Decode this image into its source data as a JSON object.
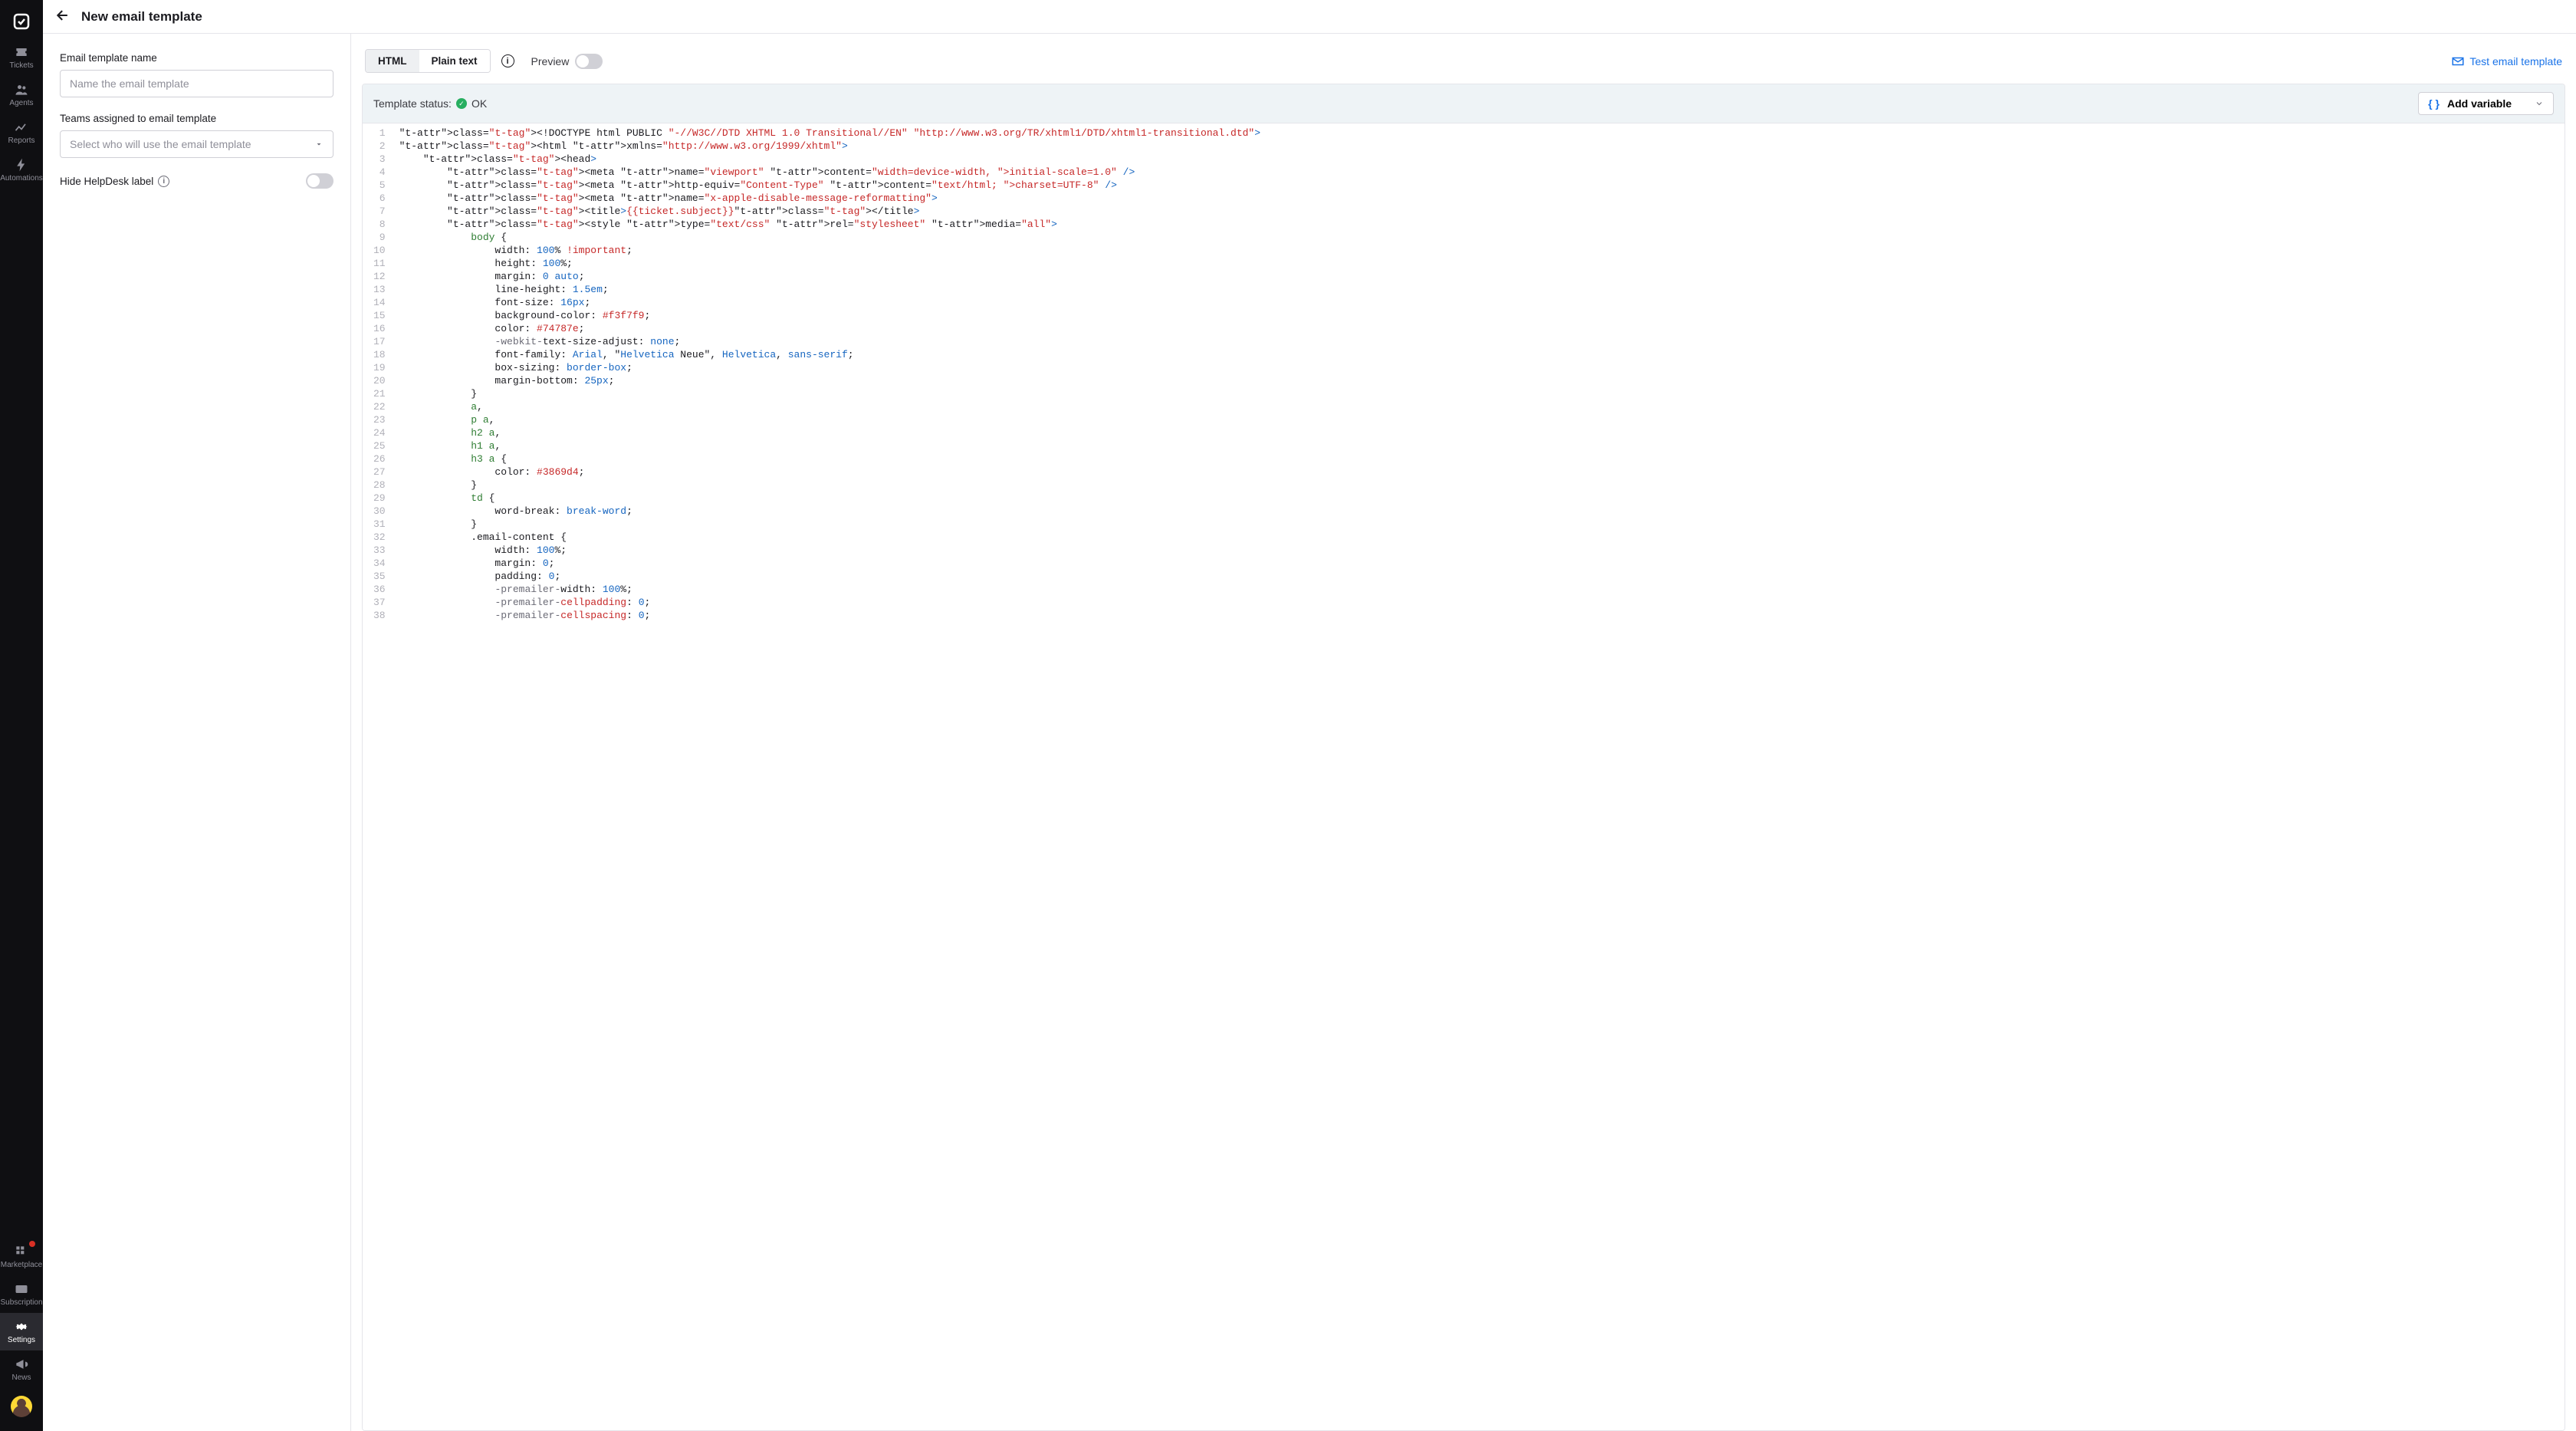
{
  "sidebar": {
    "items": [
      {
        "label": "Tickets"
      },
      {
        "label": "Agents"
      },
      {
        "label": "Reports"
      },
      {
        "label": "Automations"
      }
    ],
    "bottomItems": [
      {
        "label": "Marketplace",
        "badge": true
      },
      {
        "label": "Subscription"
      },
      {
        "label": "Settings",
        "active": true
      },
      {
        "label": "News"
      }
    ]
  },
  "header": {
    "title": "New email template"
  },
  "form": {
    "nameLabel": "Email template name",
    "namePlaceholder": "Name the email template",
    "teamsLabel": "Teams assigned to email template",
    "teamsPlaceholder": "Select who will use the email template",
    "hideLabel": "Hide HelpDesk label"
  },
  "toolbar": {
    "htmlTab": "HTML",
    "plainTab": "Plain text",
    "previewLabel": "Preview",
    "testLink": "Test email template"
  },
  "status": {
    "label": "Template status:",
    "value": "OK",
    "addVariable": "Add variable"
  },
  "code": {
    "lines": [
      "<!DOCTYPE html PUBLIC \"-//W3C//DTD XHTML 1.0 Transitional//EN\" \"http://www.w3.org/TR/xhtml1/DTD/xhtml1-transitional.dtd\">",
      "<html xmlns=\"http://www.w3.org/1999/xhtml\">",
      "    <head>",
      "        <meta name=\"viewport\" content=\"width=device-width, initial-scale=1.0\" />",
      "        <meta http-equiv=\"Content-Type\" content=\"text/html; charset=UTF-8\" />",
      "        <meta name=\"x-apple-disable-message-reformatting\">",
      "        <title>{{ticket.subject}}</title>",
      "        <style type=\"text/css\" rel=\"stylesheet\" media=\"all\">",
      "            body {",
      "                width: 100% !important;",
      "                height: 100%;",
      "                margin: 0 auto;",
      "                line-height: 1.5em;",
      "                font-size: 16px;",
      "                background-color: #f3f7f9;",
      "                color: #74787e;",
      "                -webkit-text-size-adjust: none;",
      "                font-family: Arial, \"Helvetica Neue\", Helvetica, sans-serif;",
      "                box-sizing: border-box;",
      "                margin-bottom: 25px;",
      "            }",
      "            a,",
      "            p a,",
      "            h2 a,",
      "            h1 a,",
      "            h3 a {",
      "                color: #3869d4;",
      "            }",
      "            td {",
      "                word-break: break-word;",
      "            }",
      "            .email-content {",
      "                width: 100%;",
      "                margin: 0;",
      "                padding: 0;",
      "                -premailer-width: 100%;",
      "                -premailer-cellpadding: 0;",
      "                -premailer-cellspacing: 0;"
    ]
  }
}
